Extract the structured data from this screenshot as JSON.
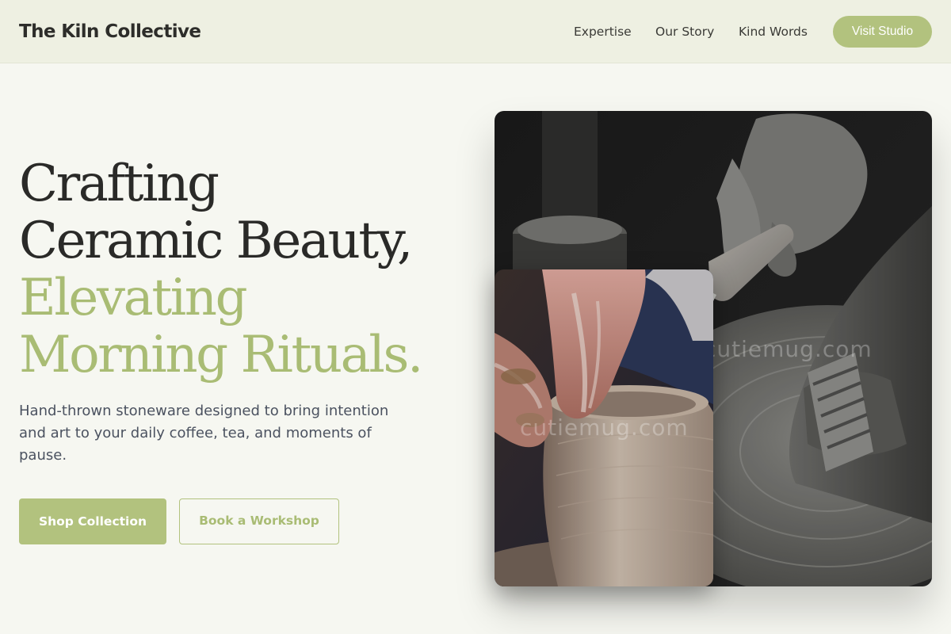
{
  "header": {
    "brand": "The Kiln Collective",
    "nav": [
      "Expertise",
      "Our Story",
      "Kind Words"
    ],
    "cta_label": "Visit Studio"
  },
  "hero": {
    "headline_lines": [
      "Crafting",
      "Ceramic Beauty,",
      "Elevating",
      "Morning Rituals."
    ],
    "subtitle": "Hand-thrown stoneware designed to bring intention and art to your daily coffee, tea, and moments of pause.",
    "primary_button": "Shop Collection",
    "secondary_button": "Book a Workshop",
    "images": {
      "back_alt": "Black and white close-up of hands carving a pot with a wooden tool",
      "front_alt": "Hands shaping wet clay on a pottery wheel",
      "back_watermark": "cutiemug.com",
      "front_watermark": "cutiemug.com"
    }
  },
  "colors": {
    "accent": "#b2c27e",
    "accent_text": "#a9bc74",
    "header_bg": "#eef0e2",
    "page_bg": "#f6f7f1",
    "heading": "#2a2a28",
    "body_text": "#4b5260"
  }
}
